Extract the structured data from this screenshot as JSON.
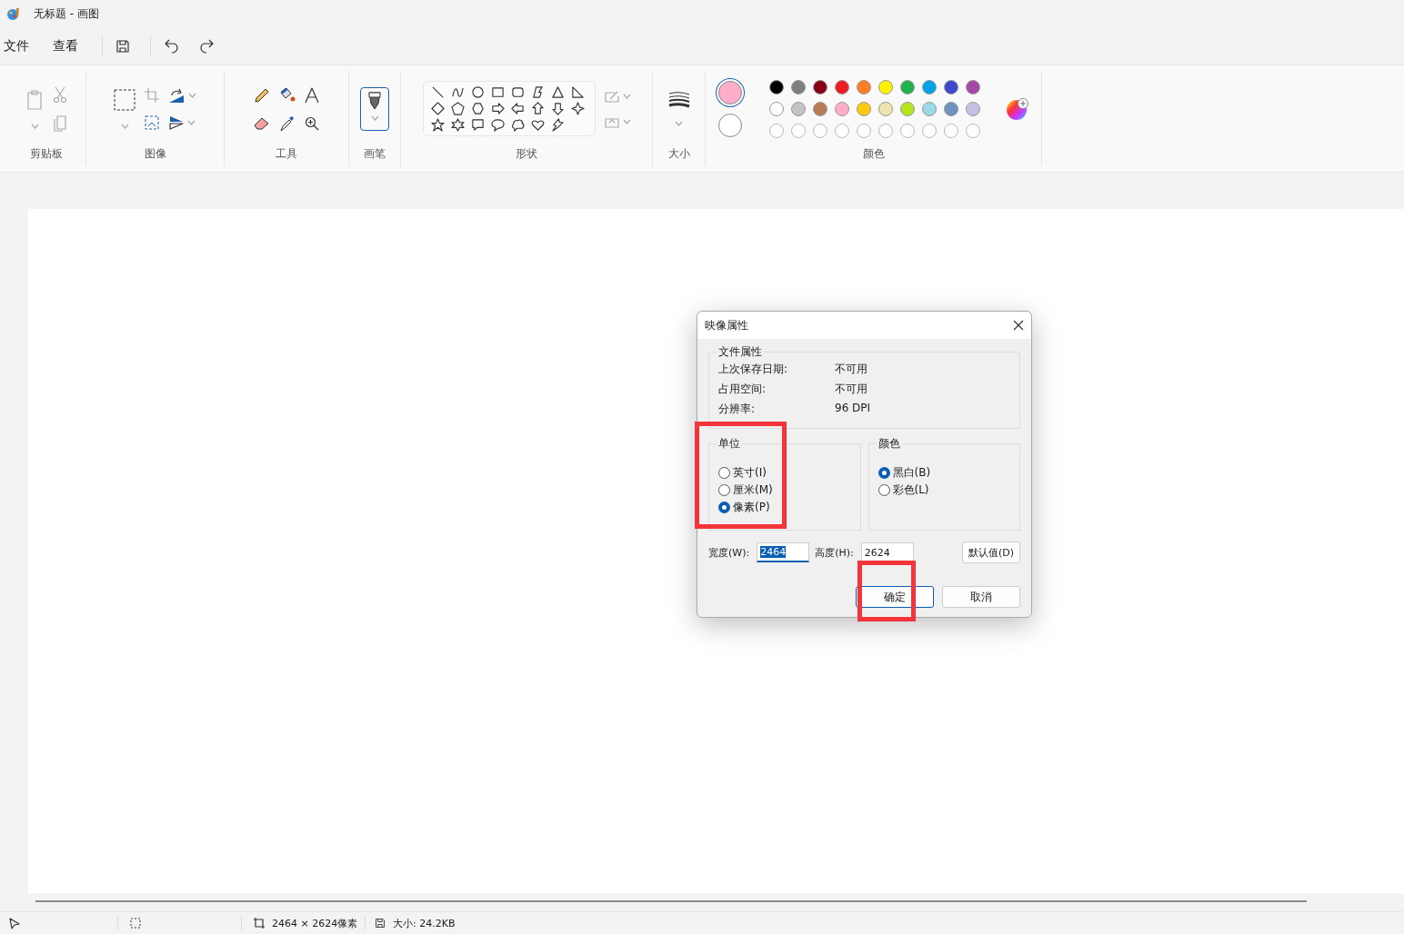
{
  "window": {
    "title": "无标题 - 画图"
  },
  "menu": [
    {
      "label": "文件"
    },
    {
      "label": "查看"
    }
  ],
  "ribbon_groups": [
    {
      "label": "剪贴板"
    },
    {
      "label": "图像"
    },
    {
      "label": "工具"
    },
    {
      "label": "画笔"
    },
    {
      "label": "形状"
    },
    {
      "label": "大小"
    },
    {
      "label": "颜色"
    }
  ],
  "current_colors": [
    {
      "color": "#ffaec9",
      "selected": true
    },
    {
      "color": "#ffffff",
      "selected": false
    }
  ],
  "palette": [
    {
      "color": "#000000"
    },
    {
      "color": "#7f7f7f"
    },
    {
      "color": "#880015"
    },
    {
      "color": "#ed1c24"
    },
    {
      "color": "#ff7f27"
    },
    {
      "color": "#fff200"
    },
    {
      "color": "#22b14c"
    },
    {
      "color": "#00a2e8"
    },
    {
      "color": "#3f48cc"
    },
    {
      "color": "#a349a4"
    },
    {
      "color": "#ffffff"
    },
    {
      "color": "#c3c3c3"
    },
    {
      "color": "#b97a57"
    },
    {
      "color": "#ffaec9"
    },
    {
      "color": "#ffc90e"
    },
    {
      "color": "#efe4b0"
    },
    {
      "color": "#b5e61d"
    },
    {
      "color": "#99d9ea"
    },
    {
      "color": "#7092be"
    },
    {
      "color": "#c8bfe7"
    },
    {
      "kind": "empty"
    },
    {
      "kind": "empty"
    },
    {
      "kind": "empty"
    },
    {
      "kind": "empty"
    },
    {
      "kind": "empty"
    },
    {
      "kind": "empty"
    },
    {
      "kind": "empty"
    },
    {
      "kind": "empty"
    },
    {
      "kind": "empty"
    },
    {
      "kind": "empty"
    }
  ],
  "dialog": {
    "title": "映像属性",
    "file_properties": {
      "legend": "文件属性",
      "rows": [
        {
          "label": "上次保存日期:",
          "value": "不可用"
        },
        {
          "label": "占用空间:",
          "value": "不可用"
        },
        {
          "label": "分辨率:",
          "value": "96 DPI"
        }
      ]
    },
    "units": {
      "legend": "单位",
      "highlighted": true,
      "options": [
        {
          "label": "英寸(I)",
          "selected": false
        },
        {
          "label": "厘米(M)",
          "selected": false
        },
        {
          "label": "像素(P)",
          "selected": true
        }
      ]
    },
    "color_mode": {
      "legend": "颜色",
      "options": [
        {
          "label": "黑白(B)",
          "selected": true
        },
        {
          "label": "彩色(L)",
          "selected": false
        }
      ]
    },
    "width": {
      "label": "宽度(W):",
      "value": "2464",
      "focused": true
    },
    "height": {
      "label": "高度(H):",
      "value": "2624",
      "focused": false
    },
    "default_button": {
      "label": "默认值(D)"
    },
    "buttons": [
      {
        "label": "确定",
        "kind": "default",
        "highlighted": true
      },
      {
        "label": "取消",
        "kind": "normal",
        "highlighted": false
      }
    ]
  },
  "status_bar": {
    "dimensions": "2464 × 2624像素",
    "size": "大小: 24.2KB"
  }
}
